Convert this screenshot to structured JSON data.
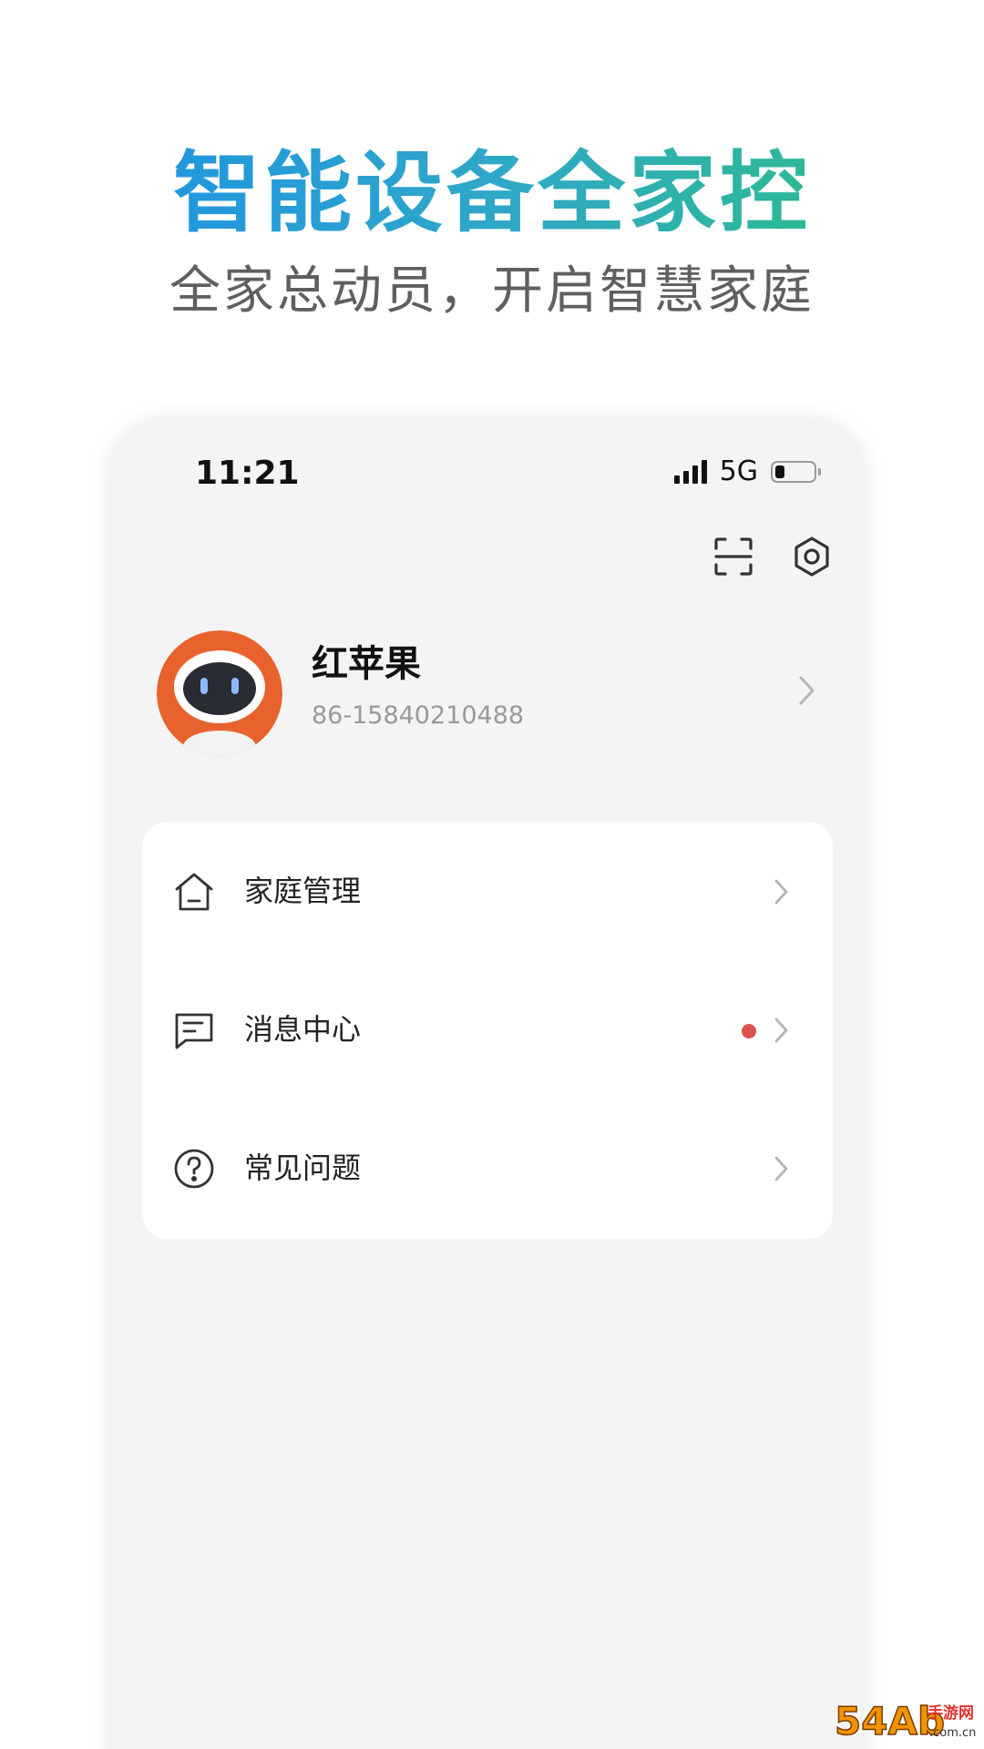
{
  "promo": {
    "headline": "智能设备全家控",
    "subheadline": "全家总动员，开启智慧家庭"
  },
  "status_bar": {
    "time": "11:21",
    "network": "5G",
    "signal_icon": "signal-bars-icon",
    "battery_icon": "battery-icon",
    "battery_level": 0.25
  },
  "toolbar": {
    "scan_icon": "scan-icon",
    "settings_icon": "settings-icon"
  },
  "profile": {
    "name": "红苹果",
    "phone": "86-15840210488",
    "avatar_icon": "robot-avatar-icon"
  },
  "menu": {
    "items": [
      {
        "label": "家庭管理",
        "icon": "home-icon",
        "has_badge": false
      },
      {
        "label": "消息中心",
        "icon": "message-icon",
        "has_badge": true
      },
      {
        "label": "常见问题",
        "icon": "help-circle-icon",
        "has_badge": false
      }
    ]
  },
  "watermark": {
    "brand": "54Ab",
    "site_text": "手游网",
    "domain": ".com.cn"
  },
  "colors": {
    "headline_start": "#1a8fe8",
    "headline_end": "#2ec27a",
    "badge_red": "#d9534f",
    "avatar_orange": "#e8622d",
    "watermark_orange": "#f29400"
  }
}
